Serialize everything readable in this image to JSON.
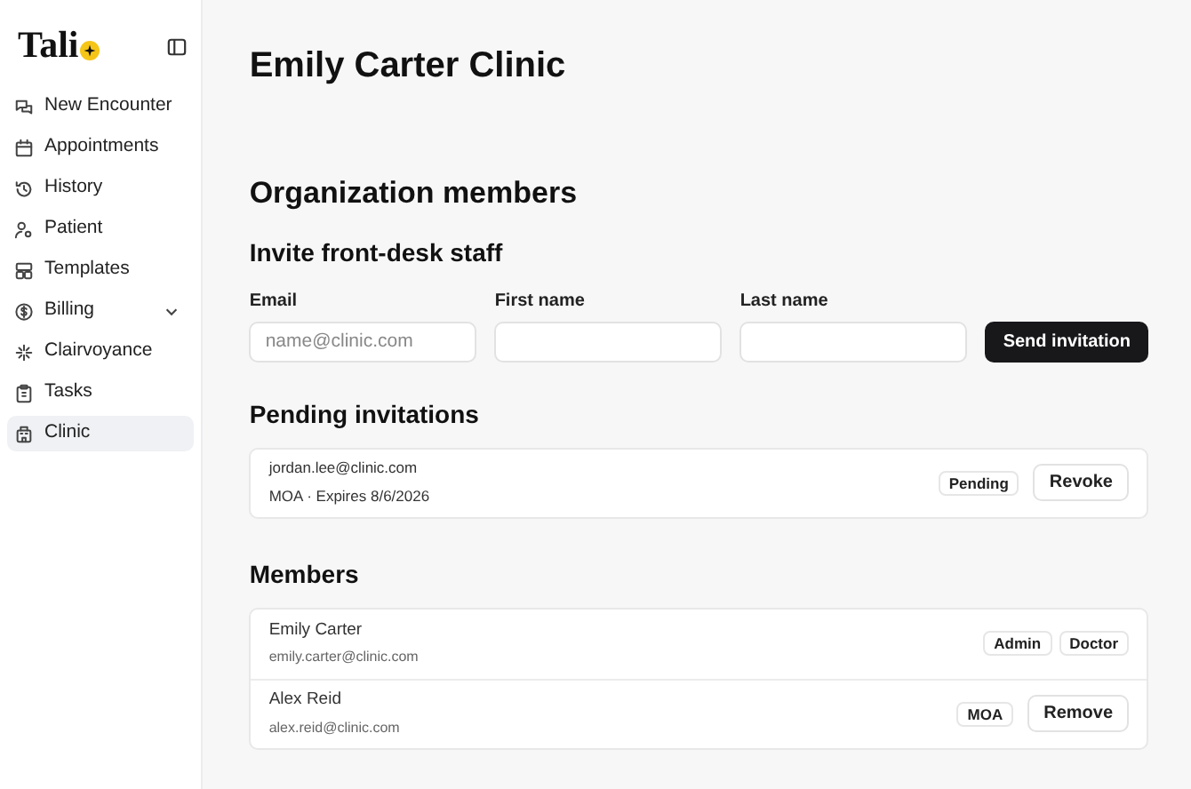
{
  "sidebar": {
    "logo": "Tali",
    "items": [
      {
        "label": "New Encounter",
        "selected": false
      },
      {
        "label": "Appointments",
        "selected": false
      },
      {
        "label": "History",
        "selected": false
      },
      {
        "label": "Patient",
        "selected": false
      },
      {
        "label": "Templates",
        "selected": false
      },
      {
        "label": "Billing",
        "selected": false,
        "expanded": false
      },
      {
        "label": "Clairvoyance",
        "selected": false
      },
      {
        "label": "Tasks",
        "selected": false
      },
      {
        "label": "Clinic",
        "selected": true
      }
    ]
  },
  "page_title": "Emily Carter Clinic",
  "section_title": "Organization members",
  "invite": {
    "title": "Invite front-desk staff",
    "fields": [
      {
        "label": "Email",
        "placeholder": "name@clinic.com"
      },
      {
        "label": "First name"
      },
      {
        "label": "Last name"
      }
    ],
    "button": "Send invitation"
  },
  "pending": {
    "title": "Pending invitations",
    "rows": [
      {
        "email": "jordan.lee@clinic.com",
        "detail": "MOA · Expires 8/6/2026",
        "badge": "Pending",
        "action": "Revoke"
      }
    ]
  },
  "members": {
    "title": "Members",
    "rows": [
      {
        "name": "Emily Carter",
        "email": "emily.carter@clinic.com",
        "roles": [
          "Admin",
          "Doctor"
        ]
      },
      {
        "name": "Alex Reid",
        "email": "alex.reid@clinic.com",
        "roles": [
          "MOA"
        ],
        "action": "Remove"
      }
    ]
  }
}
